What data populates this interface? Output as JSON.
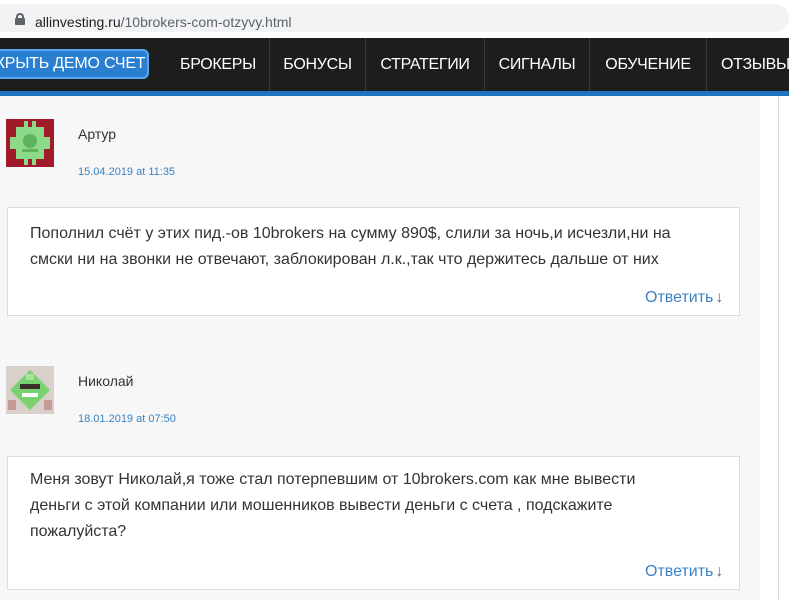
{
  "browser": {
    "url_domain": "allinvesting.ru",
    "url_path": "/10brokers-com-otzyvy.html"
  },
  "nav": {
    "demo_button": "КРЫТЬ ДЕМО СЧЕТ",
    "items": [
      "БРОКЕРЫ",
      "БОНУСЫ",
      "СТРАТЕГИИ",
      "СИГНАЛЫ",
      "ОБУЧЕНИЕ",
      "ОТЗЫВЫ"
    ]
  },
  "comments": [
    {
      "author": "Артур",
      "date": "15.04.2019 at 11:35",
      "lines": [
        "Пополнил счёт у этих пид.-ов 10brokers на сумму 890$, слили за ночь,и исчезли,ни на",
        "смски ни на звонки не отвечают, заблокирован л.к.,так что держитесь дальше от них"
      ],
      "reply_label": "Ответить",
      "reply_arrow": "↓"
    },
    {
      "author": "Николай",
      "date": "18.01.2019 at 07:50",
      "lines": [
        "Меня зовут Николай,я тоже стал потерпевшим от 10brokers.com как мне вывести",
        "деньги с этой компании или мошенников вывести деньги с счета , подскажите",
        "пожалуйста?"
      ],
      "reply_label": "Ответить",
      "reply_arrow": "↓"
    }
  ],
  "colors": {
    "nav_bg": "#1d1d1d",
    "accent": "#1e73be",
    "link": "#3a82c4",
    "content_bg": "#f7f7f7"
  },
  "icons": {
    "lock": "lock-icon",
    "avatar_1": "identicon-avatar",
    "avatar_2": "identicon-avatar",
    "reply_arrow": "down-arrow-icon"
  }
}
